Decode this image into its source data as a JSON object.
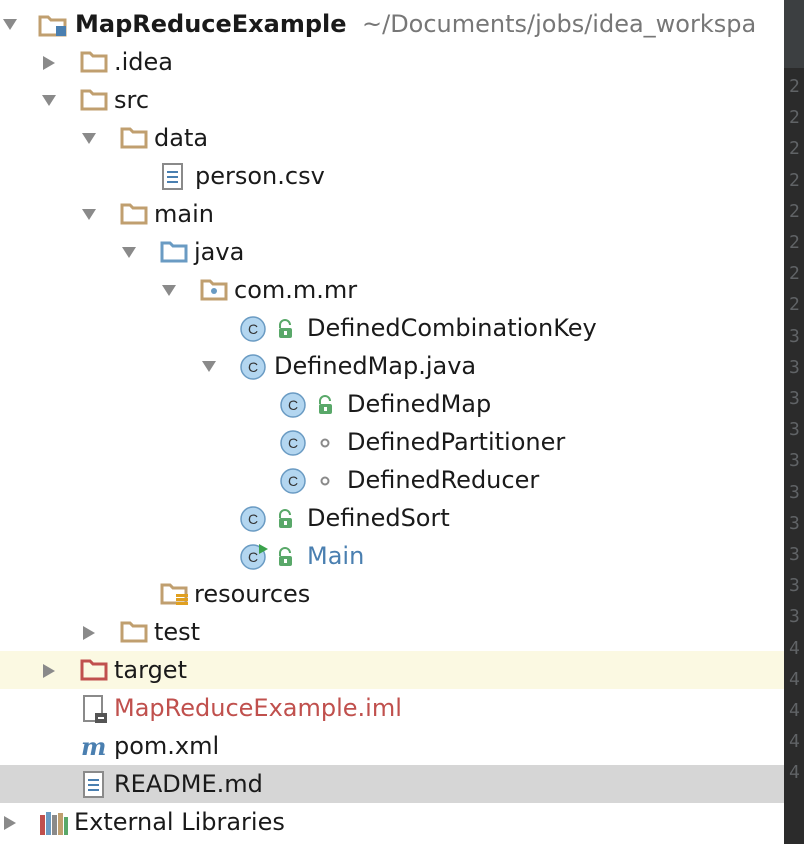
{
  "project": {
    "name": "MapReduceExample",
    "path": "~/Documents/jobs/idea_workspa"
  },
  "tree": {
    "idea": ".idea",
    "src": "src",
    "data": "data",
    "person_csv": "person.csv",
    "main": "main",
    "java": "java",
    "package": "com.m.mr",
    "defined_combination_key": "DefinedCombinationKey",
    "defined_map_java": "DefinedMap.java",
    "defined_map": "DefinedMap",
    "defined_partitioner": "DefinedPartitioner",
    "defined_reducer": "DefinedReducer",
    "defined_sort": "DefinedSort",
    "main_class": "Main",
    "resources": "resources",
    "test": "test",
    "target": "target",
    "iml": "MapReduceExample.iml",
    "pom": "pom.xml",
    "readme": "README.md",
    "external_libraries": "External Libraries"
  },
  "gutter": {
    "lines": [
      "2",
      "2",
      "2",
      "2",
      "2",
      "2",
      "2",
      "2",
      "3",
      "3",
      "3",
      "3",
      "3",
      "3",
      "3",
      "3",
      "3",
      "3",
      "4",
      "4",
      "4",
      "4",
      "4"
    ]
  },
  "colors": {
    "highlight_yellow": "#fbf9e2",
    "selected_gray": "#d6d6d6",
    "folder": "#c09f6f",
    "source_folder": "#6a9bc3",
    "excluded_folder": "#c0504d",
    "class_badge": "#b3d6f0",
    "lock_green": "#59a869"
  }
}
